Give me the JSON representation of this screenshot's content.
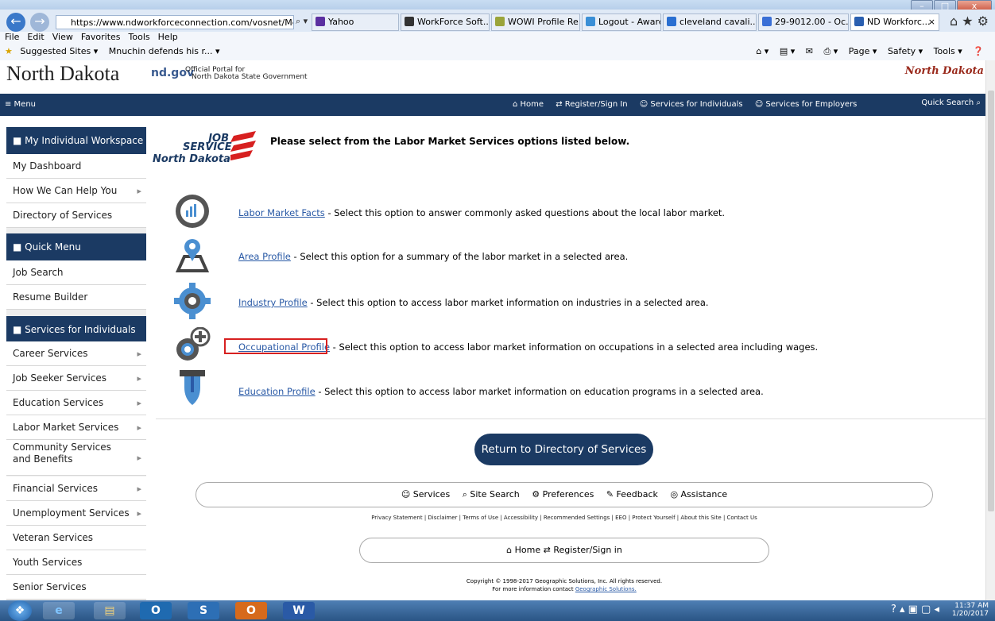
{
  "browser": {
    "url": "https://www.ndworkforceconnection.com/vosnet/Men",
    "url_actions": "⌕ ▾ 🔒 ↻",
    "tabs": [
      {
        "label": "Yahoo",
        "color": "#5b2fa0"
      },
      {
        "label": "WorkForce Soft...",
        "color": "#333333"
      },
      {
        "label": "WOWI Profile Re...",
        "color": "#9aa43a"
      },
      {
        "label": "Logout - Aware",
        "color": "#3a8fd6"
      },
      {
        "label": "cleveland cavali...",
        "color": "#2a6fd1"
      },
      {
        "label": "29-9012.00 - Oc...",
        "color": "#3a6fd6"
      },
      {
        "label": "ND Workforc...",
        "color": "#2a5fb0"
      }
    ],
    "tab_close": "×",
    "menu": [
      "File",
      "Edit",
      "View",
      "Favorites",
      "Tools",
      "Help"
    ],
    "favorites": [
      "Suggested Sites ▾",
      "Mnuchin defends his r... ▾"
    ],
    "commands": [
      "Page ▾",
      "Safety ▾",
      "Tools ▾"
    ],
    "window_controls": [
      "–",
      "□",
      "x"
    ]
  },
  "site": {
    "state_title": "North Dakota",
    "ndgov": "nd.gov",
    "portal_line1": "Official Portal for",
    "portal_line2": "North Dakota State Government",
    "nd_logo_text": "North Dakota",
    "menu_label": "≡ Menu",
    "nav": [
      "⌂ Home",
      "⇄ Register/Sign In",
      "☺ Services for Individuals",
      "☺ Services for Employers"
    ],
    "quick_search": "Quick Search ⌕"
  },
  "sidebar": {
    "sections": [
      {
        "title": "My Individual Workspace",
        "items": [
          "My Dashboard",
          "How We Can Help You",
          "Directory of Services"
        ]
      },
      {
        "title": "Quick Menu",
        "items": [
          "Job Search",
          "Resume Builder"
        ]
      },
      {
        "title": "Services for Individuals",
        "items": [
          "Career Services",
          "Job Seeker Services",
          "Education Services",
          "Labor Market Services",
          "Community Services and Benefits",
          "Financial Services",
          "Unemployment Services",
          "Veteran Services",
          "Youth Services",
          "Senior Services"
        ]
      }
    ]
  },
  "main": {
    "logo": {
      "line1": "JOB",
      "line2": "SERVICE",
      "line3": "North Dakota"
    },
    "intro": "Please select from the Labor Market Services options listed below.",
    "options": [
      {
        "link": "Labor Market Facts",
        "desc": " - Select this option to answer commonly asked questions about the local labor market."
      },
      {
        "link": "Area Profile",
        "desc": " - Select this option for a summary of the labor market in a selected area."
      },
      {
        "link": "Industry Profile",
        "desc": " - Select this option to access labor market information on industries in a selected area."
      },
      {
        "link": "Occupational Profile",
        "desc": " - Select this option to access labor market information on occupations in a selected area including wages."
      },
      {
        "link": "Education Profile",
        "desc": " - Select this option to access labor market information on education programs in a selected area."
      }
    ],
    "return_button": "Return to Directory of Services"
  },
  "footer": {
    "links": [
      "☺ Services",
      "⌕ Site Search",
      "⚙ Preferences",
      "✎ Feedback",
      "◎ Assistance"
    ],
    "legal": "Privacy Statement | Disclaimer | Terms of Use | Accessibility | Recommended Settings | EEO | Protect Yourself | About this Site | Contact Us",
    "bar2": [
      "⌂ Home",
      "⇄ Register/Sign in"
    ],
    "copyright": "Copyright © 1998-2017 Geographic Solutions, Inc. All rights reserved.",
    "contact_prefix": "For more information contact ",
    "contact_link": "Geographic Solutions."
  },
  "taskbar": {
    "apps": [
      "e",
      "▤",
      "O",
      "S",
      "O",
      "W"
    ],
    "time": "11:37 AM",
    "date": "1/20/2017",
    "tray": "? ▴ ▣ ▢ ◂"
  }
}
